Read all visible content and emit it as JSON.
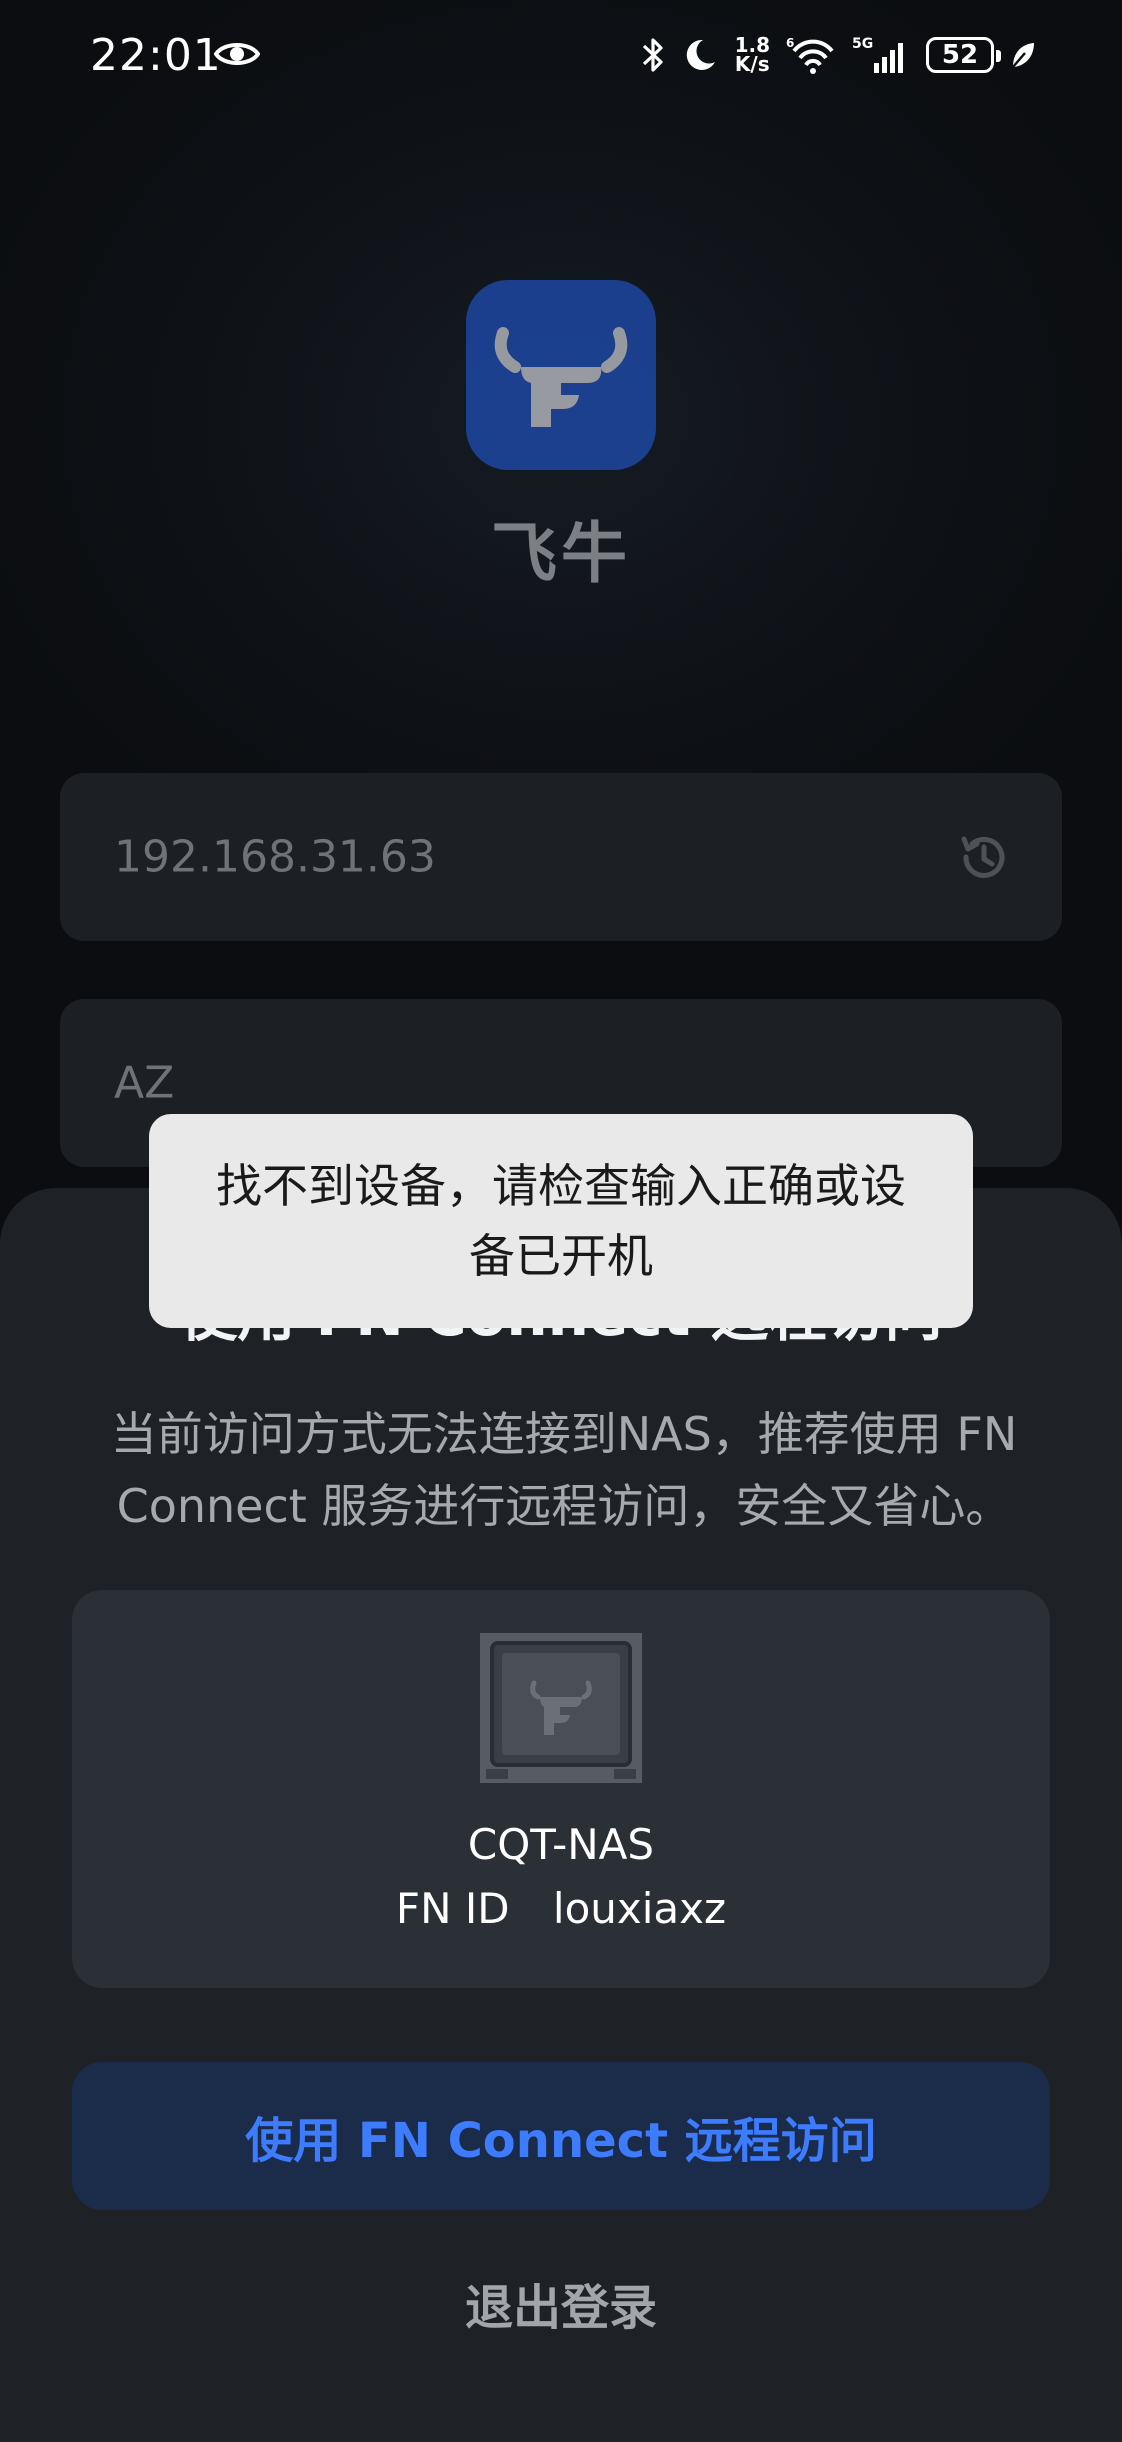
{
  "status_bar": {
    "time": "22:01",
    "net_speed_value": "1.8",
    "net_speed_unit": "K/s",
    "battery": "52",
    "signal_label": "5G",
    "wifi_index": "6"
  },
  "app": {
    "name": "飞牛",
    "brand_color": "#1f4fb8"
  },
  "login": {
    "address_value": "192.168.31.63",
    "username_value": "AZ"
  },
  "toast": {
    "message": "找不到设备，请检查输入正确或设备已开机"
  },
  "sheet": {
    "title": "使用 FN Connect 远程访问",
    "description": "当前访问方式无法连接到NAS，推荐使用 FN Connect 服务进行远程访问，安全又省心。",
    "device": {
      "name": "CQT-NAS",
      "id_label": "FN ID",
      "id_value": "louxiaxz"
    },
    "connect_button": "使用 FN Connect 远程访问",
    "logout_label": "退出登录",
    "accent_color": "#3d7bff"
  }
}
